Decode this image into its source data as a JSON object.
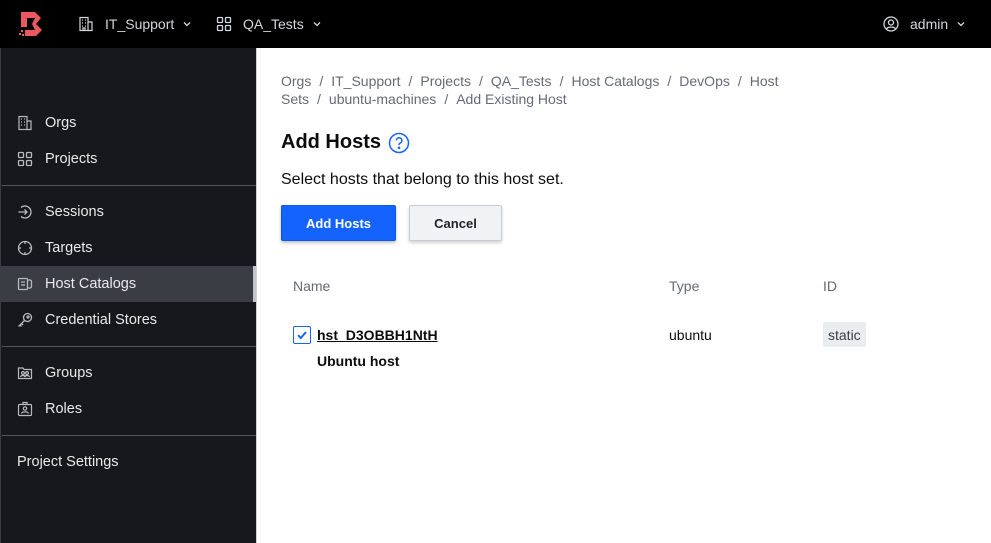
{
  "topbar": {
    "brand_color": "#ec585d",
    "org_selector": {
      "label": "IT_Support",
      "icon": "building-icon"
    },
    "project_selector": {
      "label": "QA_Tests",
      "icon": "grid-icon"
    },
    "user_menu": {
      "label": "admin",
      "icon": "user-circle-icon"
    }
  },
  "sidebar": {
    "items": [
      {
        "label": "Orgs",
        "icon": "building-icon",
        "active": false
      },
      {
        "label": "Projects",
        "icon": "grid-icon",
        "active": false
      },
      {
        "label": "Sessions",
        "icon": "entry-icon",
        "active": false
      },
      {
        "label": "Targets",
        "icon": "crosshair-icon",
        "active": false
      },
      {
        "label": "Host Catalogs",
        "icon": "server-icon",
        "active": true
      },
      {
        "label": "Credential Stores",
        "icon": "key-icon",
        "active": false
      },
      {
        "label": "Groups",
        "icon": "users-folder-icon",
        "active": false
      },
      {
        "label": "Roles",
        "icon": "id-badge-icon",
        "active": false
      },
      {
        "label": "Project Settings",
        "active": false
      }
    ]
  },
  "breadcrumb": [
    "Orgs",
    "IT_Support",
    "Projects",
    "QA_Tests",
    "Host Catalogs",
    "DevOps",
    "Host Sets",
    "ubuntu-machines",
    "Add Existing Host"
  ],
  "page": {
    "title": "Add Hosts",
    "help_icon": "question-circle-icon",
    "description": "Select hosts that belong to this host set.",
    "primary_button": "Add Hosts",
    "secondary_button": "Cancel"
  },
  "table": {
    "headers": [
      "Name",
      "Type",
      "ID"
    ],
    "rows": [
      {
        "checked": true,
        "name": "hst_D3OBBH1NtH",
        "description": "Ubuntu host",
        "type": "ubuntu",
        "id": "static"
      }
    ]
  },
  "colors": {
    "accent": "#1563ff",
    "sidebar_bg": "#17181d",
    "sidebar_active": "#3b3d45"
  }
}
